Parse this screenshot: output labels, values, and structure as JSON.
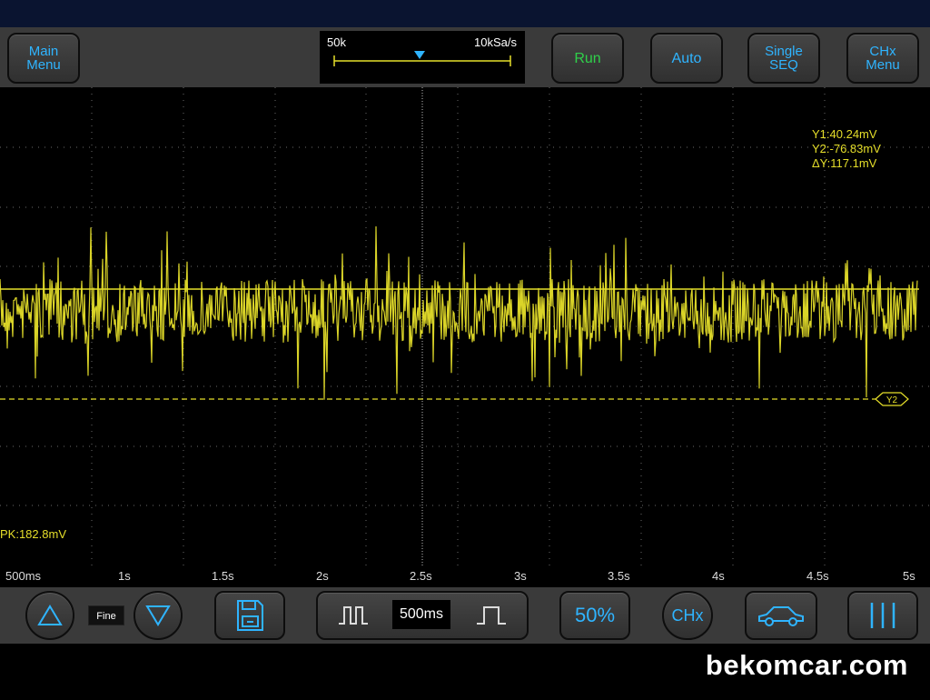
{
  "top_bar": {
    "main_menu": [
      "Main",
      "Menu"
    ],
    "timebase_panel": {
      "memory_depth": "50k",
      "sample_rate": "10kSa/s"
    },
    "run": "Run",
    "auto": "Auto",
    "single_seq": [
      "Single",
      "SEQ"
    ],
    "chx_menu": [
      "CHx",
      "Menu"
    ]
  },
  "screen": {
    "cursor_y1": "Y1:40.24mV",
    "cursor_y2": "Y2:-76.83mV",
    "cursor_delta": "ΔY:117.1mV",
    "cursor_marker_label": "Y2",
    "peak_to_peak": "PK:182.8mV"
  },
  "time_axis": {
    "ticks": [
      "500ms",
      "1s",
      "1.5s",
      "2s",
      "2.5s",
      "3s",
      "3.5s",
      "4s",
      "4.5s",
      "5s"
    ]
  },
  "bottom_bar": {
    "fine_label": "Fine",
    "timebase_value": "500ms",
    "percent_button": "50%",
    "chx_button": "CHx"
  },
  "watermark": "bekomcar.com",
  "colors": {
    "accent": "#2fb4ff",
    "run_green": "#2fd04a",
    "trace_yellow": "#e6df2a",
    "panel_gray": "#3a3a3a"
  }
}
